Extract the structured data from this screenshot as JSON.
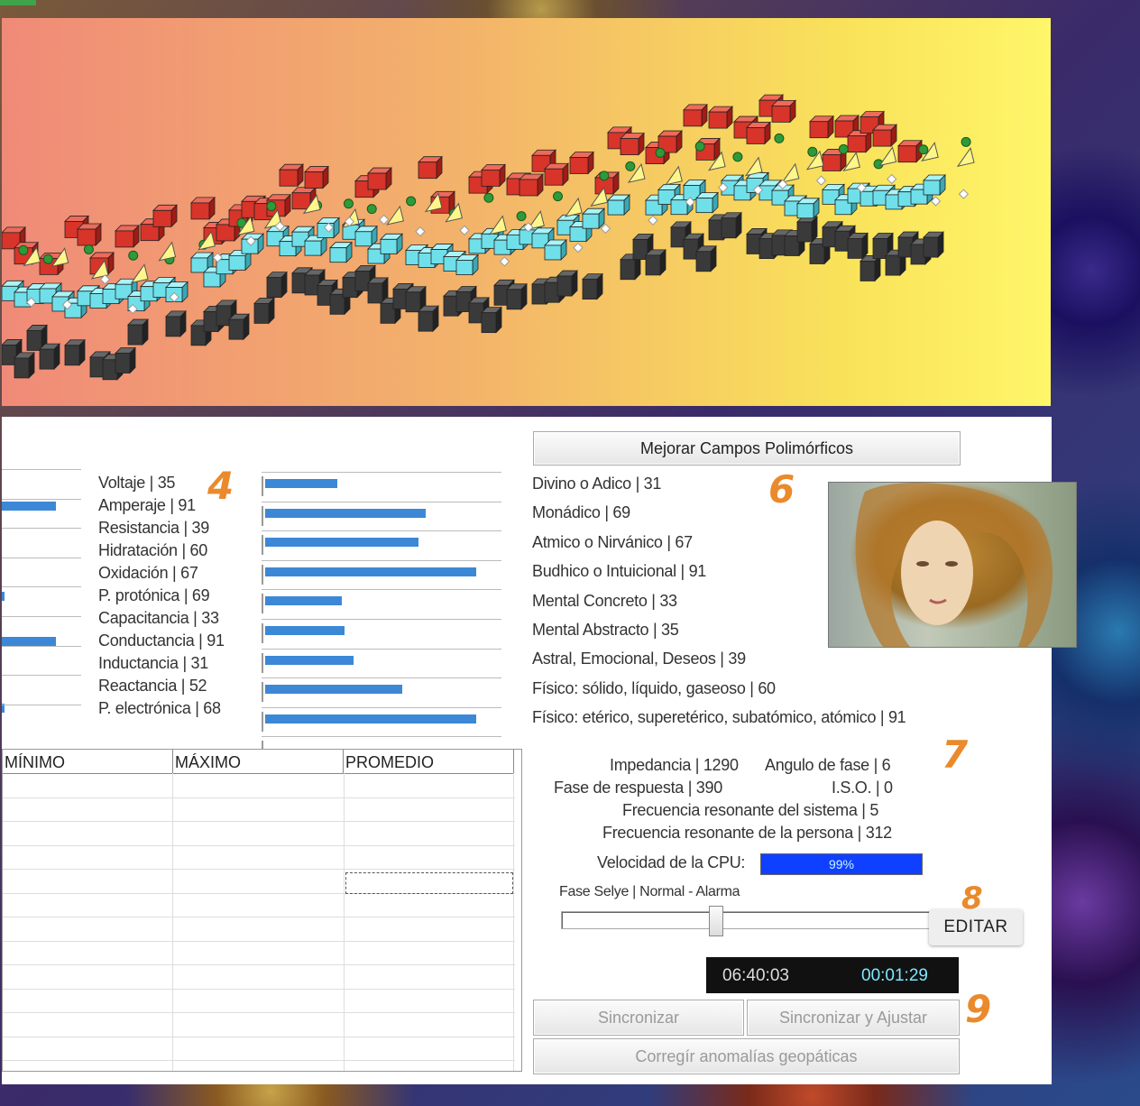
{
  "colors": {
    "accent": "#3c88d6",
    "number": "#ea8a2c",
    "cpu": "#1040ff"
  },
  "section_numbers": {
    "n4": "4",
    "n6": "6",
    "n7": "7",
    "n8": "8",
    "n9": "9"
  },
  "electrical": {
    "items": [
      {
        "label": "Voltaje | 35",
        "level": 0.35
      },
      {
        "label": "Amperaje | 91",
        "level": 0.91
      },
      {
        "label": "Resistancia | 39",
        "level": 0.39
      },
      {
        "label": "Hidratación | 60",
        "level": 0.6
      },
      {
        "label": "Oxidación | 67",
        "level": 0.67
      },
      {
        "label": "P. protónica | 69",
        "level": 0.69
      },
      {
        "label": "Capacitancia | 33",
        "level": 0.33
      },
      {
        "label": "Conductancia | 91",
        "level": 0.91
      },
      {
        "label": "Inductancia | 31",
        "level": 0.31
      },
      {
        "label": "Reactancia | 52",
        "level": 0.52
      },
      {
        "label": "P. electrónica | 68",
        "level": 0.68
      }
    ]
  },
  "bar_levels": [
    0.3,
    0.67,
    0.64,
    0.88,
    0.32,
    0.33,
    0.37,
    0.57,
    0.88
  ],
  "left_partial_bars": [
    0.24,
    0.01,
    0.24,
    0.01
  ],
  "polymorphic": {
    "button": "Mejorar Campos Polimórficos",
    "items": [
      "Divino o Adico | 31",
      "Monádico | 69",
      "Atmico o Nirvánico | 67",
      "Budhico o Intuicional | 91",
      "Mental Concreto | 33",
      "Mental Abstracto | 35",
      "Astral, Emocional, Deseos | 39",
      "Físico: sólido, líquido, gaseoso | 60",
      "Físico: etérico, superetérico, subatómico, atómico | 91"
    ],
    "portrait_icon": "venus-portrait-image"
  },
  "table": {
    "headers": [
      "MÍNIMO",
      "MÁXIMO",
      "PROMEDIO"
    ]
  },
  "system": {
    "impedancia": "Impedancia | 1290",
    "angulo": "Angulo de fase | 6",
    "fase_respuesta": "Fase de respuesta | 390",
    "iso": "I.S.O. | 0",
    "freq_sistema": "Frecuencia resonante del sistema | 5",
    "freq_persona": "Frecuencia resonante de la persona | 312",
    "cpu_label": "Velocidad de la CPU:",
    "cpu_value": "99%",
    "cpu_level": 0.99,
    "selye_label": "Fase Selye | Normal - Alarma",
    "selye_level": 0.41,
    "edit": "EDITAR"
  },
  "timer": {
    "clock": "06:40:03",
    "elapsed": "00:01:29"
  },
  "actions": {
    "sync": "Sincronizar",
    "sync_adjust": "Sincronizar y Ajustar",
    "correct": "Corregír anomalías geopáticas"
  }
}
